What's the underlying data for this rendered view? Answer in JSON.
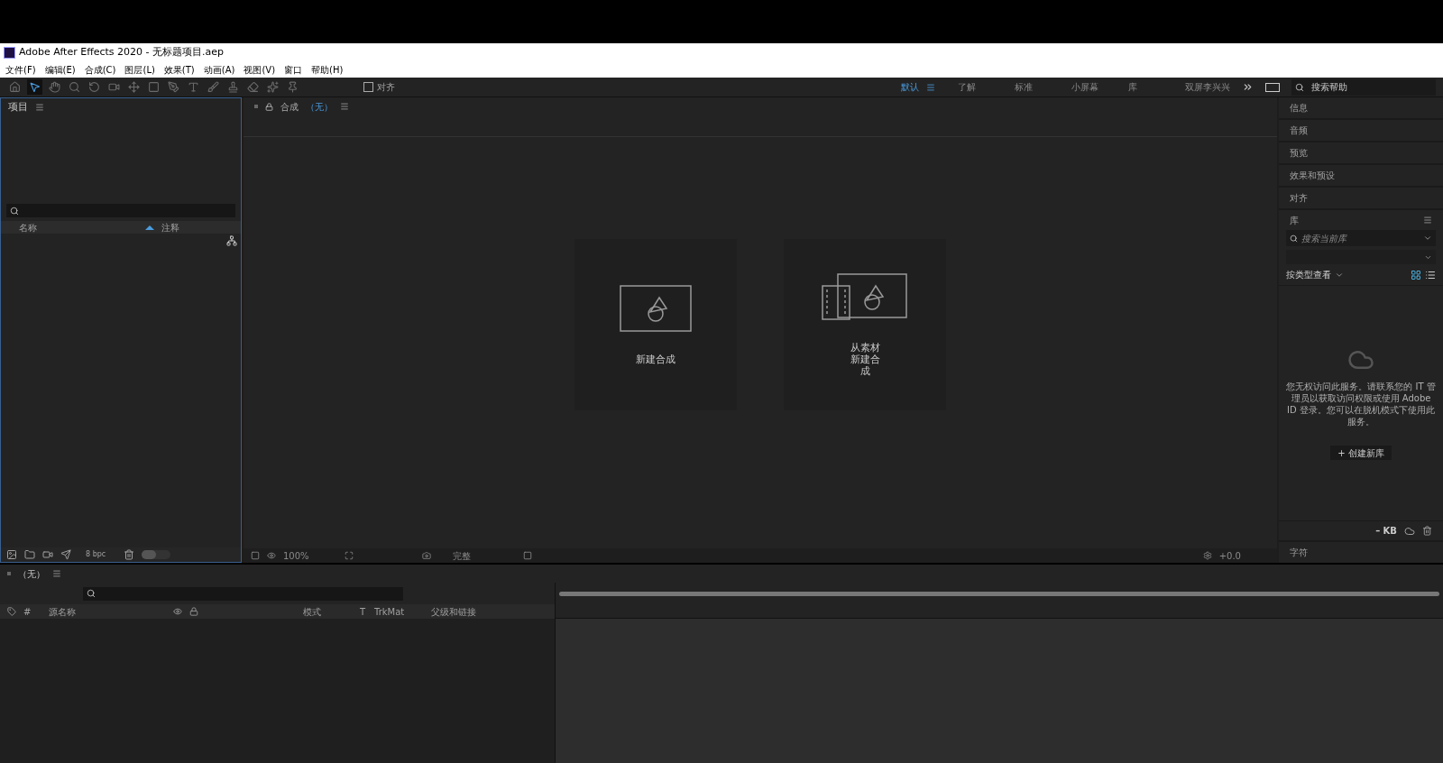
{
  "window": {
    "title": "Adobe After Effects 2020 - 无标题项目.aep"
  },
  "menu": [
    "文件(F)",
    "编辑(E)",
    "合成(C)",
    "图层(L)",
    "效果(T)",
    "动画(A)",
    "视图(V)",
    "窗口",
    "帮助(H)"
  ],
  "tools": [
    {
      "kind": "home",
      "selected": false
    },
    {
      "kind": "select",
      "selected": true
    },
    {
      "kind": "hand",
      "selected": false
    },
    {
      "kind": "zoom",
      "selected": false
    },
    {
      "kind": "rotate",
      "selected": false
    },
    {
      "kind": "camera",
      "selected": false
    },
    {
      "kind": "anchor",
      "selected": false
    },
    {
      "kind": "rect",
      "selected": false
    },
    {
      "kind": "pen",
      "selected": false
    },
    {
      "kind": "type",
      "selected": false
    },
    {
      "kind": "brush",
      "selected": false
    },
    {
      "kind": "stamp",
      "selected": false
    },
    {
      "kind": "eraser",
      "selected": false
    },
    {
      "kind": "roto",
      "selected": false
    },
    {
      "kind": "pin",
      "selected": false
    }
  ],
  "snap": {
    "label": "对齐",
    "checked": false
  },
  "workspaces": [
    {
      "label": "默认",
      "selected": true
    },
    {
      "label": "了解",
      "selected": false
    },
    {
      "label": "标准",
      "selected": false
    },
    {
      "label": "小屏幕",
      "selected": false
    },
    {
      "label": "库",
      "selected": false
    },
    {
      "label": "双屏李兴兴",
      "selected": false
    }
  ],
  "help_search": {
    "placeholder": "搜索帮助"
  },
  "project_panel": {
    "title": "项目",
    "columns": [
      "名称",
      "注释"
    ],
    "bpc": "8 bpc",
    "thumbnail_size": {
      "level": 0.5
    }
  },
  "composition_panel": {
    "title": "合成",
    "comp_name": "（无）",
    "cards": [
      {
        "kind": "new",
        "label": "新建合成"
      },
      {
        "kind": "footage",
        "label": "从素材新建合成"
      }
    ],
    "zoom": "100%",
    "resolution": "完整",
    "exposure": "+0.0"
  },
  "right_panels": [
    "信息",
    "音频",
    "预览",
    "效果和预设",
    "对齐"
  ],
  "library": {
    "title": "库",
    "search_placeholder": "搜索当前库",
    "view_by": "按类型查看",
    "view_buttons": [
      {
        "kind": "grid",
        "selected": true
      },
      {
        "kind": "list",
        "selected": false
      }
    ],
    "message": "您无权访问此服务。请联系您的 IT 管理员以获取访问权限或使用 Adobe ID 登录。您可以在脱机模式下使用此服务。",
    "create_button": "+ 创建新库",
    "size": "– KB"
  },
  "bottom_panels": [
    "字符"
  ],
  "timeline": {
    "title": "（无）",
    "columns": [
      "#",
      "源名称",
      "模式",
      "T",
      "TrkMat",
      "父级和链接"
    ]
  }
}
